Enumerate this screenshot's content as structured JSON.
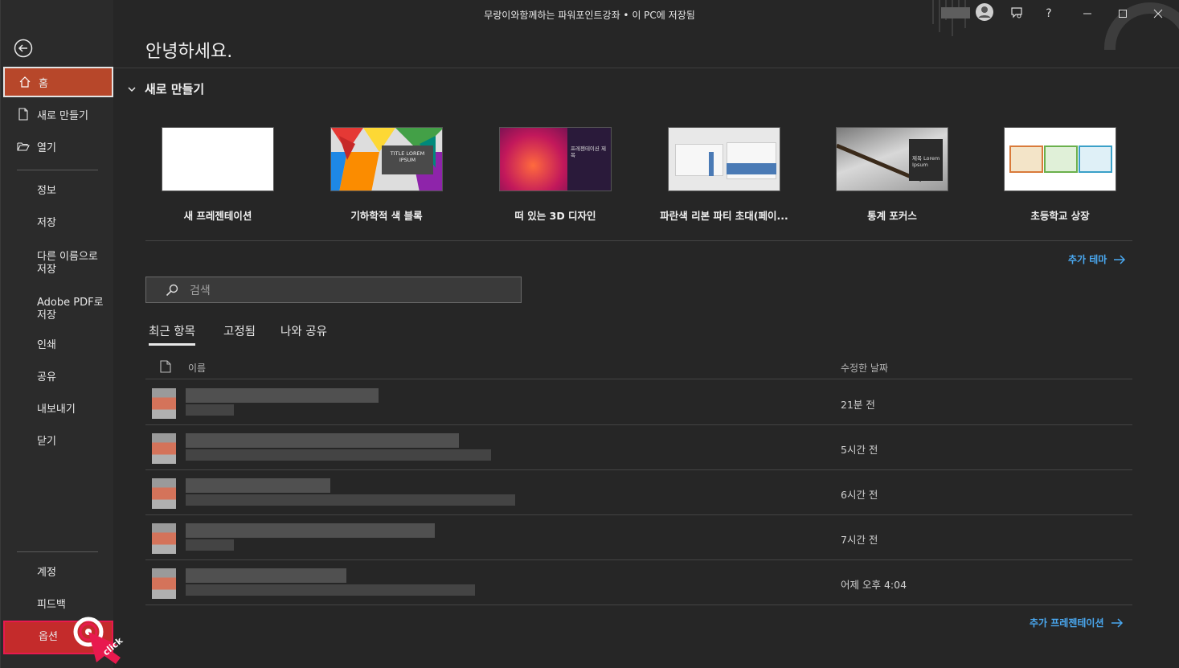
{
  "window": {
    "title": "무랑이와함께하는 파워포인트강좌 • 이 PC에 저장됨",
    "help": "?"
  },
  "sidebar": {
    "home": "홈",
    "new": "새로 만들기",
    "open": "열기",
    "info": "정보",
    "save": "저장",
    "save_as": [
      "다른 이름으로",
      "저장"
    ],
    "save_pdf": [
      "Adobe PDF로",
      "저장"
    ],
    "print": "인쇄",
    "share": "공유",
    "export": "내보내기",
    "close": "닫기",
    "account": "계정",
    "feedback": "피드백",
    "options": "옵션"
  },
  "main": {
    "greeting": "안녕하세요.",
    "new_section": "새로 만들기",
    "templates": [
      {
        "label": "새 프레젠테이션"
      },
      {
        "label": "기하학적 색 블록",
        "thumb_text": "TITLE LOREM IPSUM"
      },
      {
        "label": "떠 있는 3D 디자인",
        "thumb_text": "프레젠테이션 제목"
      },
      {
        "label": "파란색 리본 파티 초대(페이..."
      },
      {
        "label": "통계 포커스",
        "thumb_text": "제목 Lorem Ipsum"
      },
      {
        "label": "초등학교 상장"
      }
    ],
    "more_themes": "추가 테마",
    "search_placeholder": "검색",
    "tabs": [
      "최근 항목",
      "고정됨",
      "나와 공유"
    ],
    "list_headers": {
      "name": "이름",
      "modified": "수정한 날짜"
    },
    "recent": [
      {
        "modified": "21분 전"
      },
      {
        "modified": "5시간 전"
      },
      {
        "modified": "6시간 전"
      },
      {
        "modified": "7시간 전"
      },
      {
        "modified": "어제 오후 4:04"
      }
    ],
    "more_presentations": "추가 프레젠테이션"
  },
  "overlay": {
    "click_label": "click"
  },
  "colors": {
    "accent": "#b7472a",
    "link": "#4aa8f0",
    "highlight": "#e8194e"
  }
}
